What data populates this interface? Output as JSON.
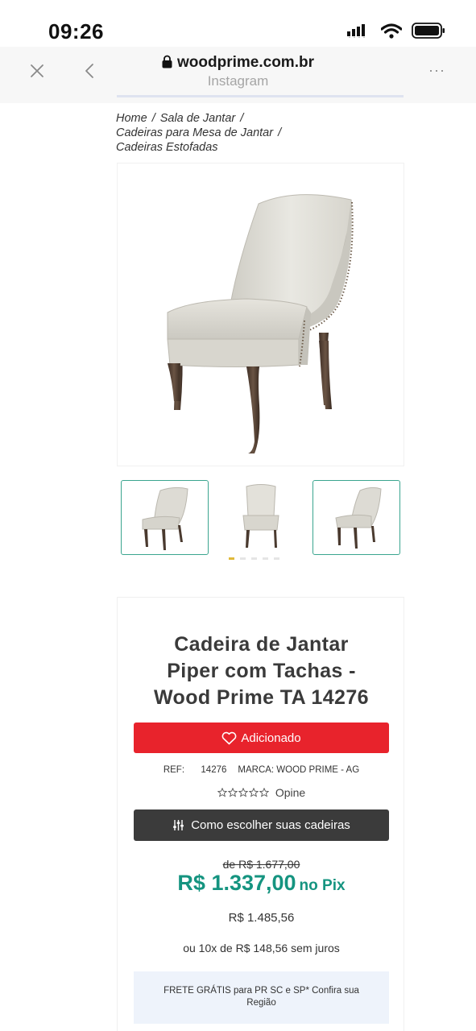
{
  "status_bar": {
    "time": "09:26"
  },
  "browser": {
    "url": "woodprime.com.br",
    "subtitle": "Instagram",
    "more_label": "···"
  },
  "breadcrumb": {
    "items": [
      "Home",
      "Sala de Jantar",
      "Cadeiras para Mesa de Jantar",
      "Cadeiras Estofadas"
    ],
    "separator": "/"
  },
  "gallery": {
    "main_image": "chair-photo",
    "thumbnails": [
      "chair-angle-left",
      "chair-front",
      "chair-angle-right"
    ],
    "active_dot": 0,
    "dot_count": 5
  },
  "product": {
    "title_lines": [
      "Cadeira de Jantar",
      "Piper com Tachas -",
      "Wood Prime TA 14276"
    ],
    "add_button_label": "Adicionado",
    "ref_label": "REF:",
    "ref_value": "14276",
    "brand_label": "MARCA: WOOD PRIME - AG",
    "rating_label": "Opine",
    "how_button_label": "Como escolher suas cadeiras",
    "old_price": "de R$ 1.677,00",
    "pix_price": "R$ 1.337,00",
    "pix_label": "no Pix",
    "card_price": "R$ 1.485,56",
    "installments": "ou 10x de R$ 148,56 sem juros",
    "shipping_note": "FRETE GRÁTIS para PR SC e SP* Confira sua Região"
  },
  "colors": {
    "add_button": "#e8232c",
    "how_button": "#3b3b3b",
    "pix_price": "#159480",
    "thumb_border": "#3aa58f",
    "shipping_bg": "#eef3fb"
  }
}
